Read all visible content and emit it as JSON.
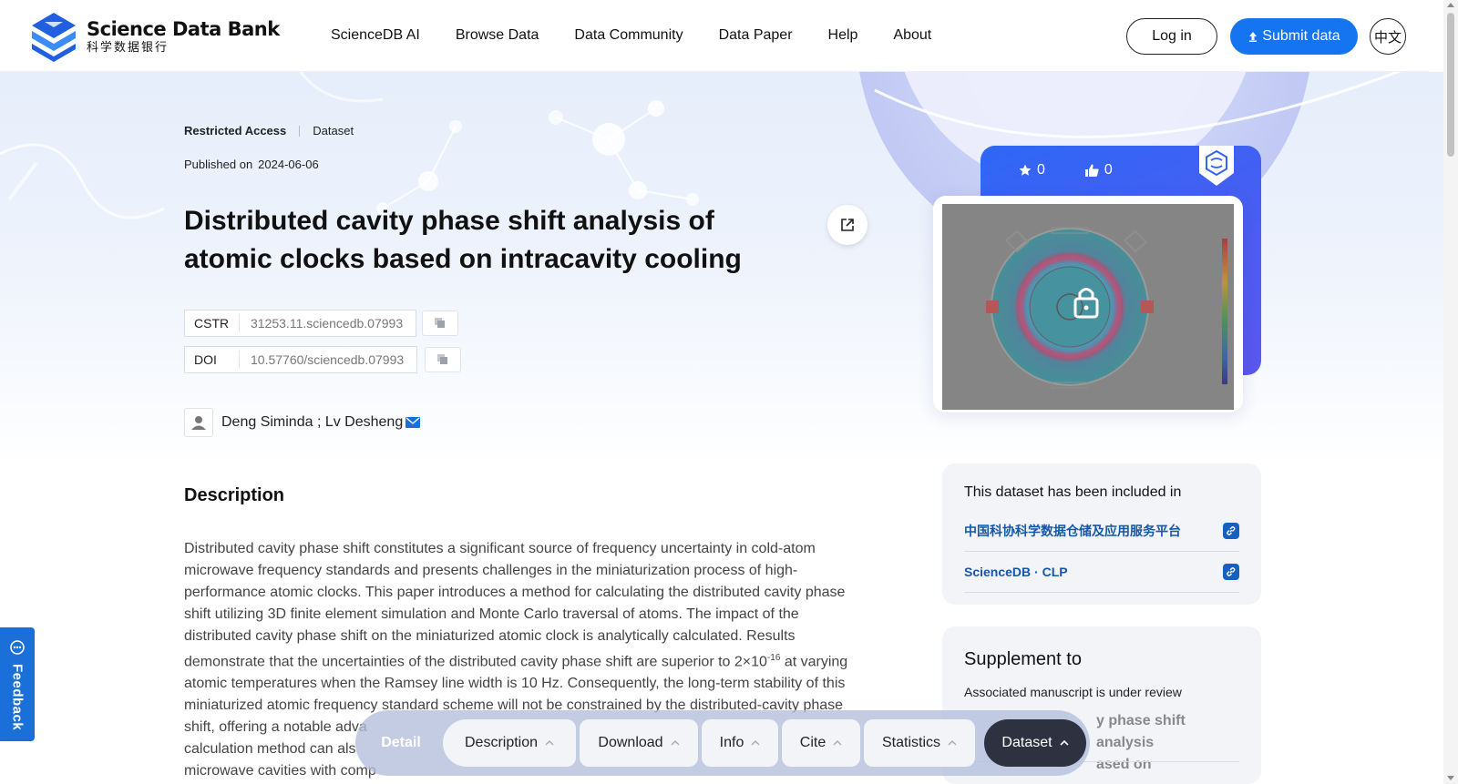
{
  "header": {
    "logo_en": "Science Data Bank",
    "logo_cn": "科学数据银行",
    "nav": [
      "ScienceDB AI",
      "Browse Data",
      "Data Community",
      "Data Paper",
      "Help",
      "About"
    ],
    "login_label": "Log in",
    "submit_label": "Submit data",
    "lang_label": "中文"
  },
  "dataset": {
    "access": "Restricted Access",
    "type": "Dataset",
    "published_label": "Published on",
    "published_date": "2024-06-06",
    "title": "Distributed cavity phase shift analysis of atomic clocks based on intracavity cooling",
    "cstr_label": "CSTR",
    "cstr_value": "31253.11.sciencedb.07993",
    "doi_label": "DOI",
    "doi_value": "10.57760/sciencedb.07993",
    "authors": "Deng Siminda ; Lv Desheng"
  },
  "description": {
    "heading": "Description",
    "text_before_exp": "Distributed cavity phase shift constitutes a significant source of frequency uncertainty in cold-atom microwave frequency standards and presents challenges in the miniaturization process of high-performance atomic clocks. This paper introduces a method for calculating the distributed cavity phase shift utilizing 3D finite element simulation and Monte Carlo traversal of atoms. The impact of the distributed cavity phase shift on the miniaturized atomic clock is analytically calculated. Results demonstrate that the uncertainties of the distributed cavity phase shift are superior to 2×10",
    "exponent": "-16",
    "text_after_exp": " at varying atomic temperatures when the Ramsey line width is 10 Hz. Consequently, the long-term stability of this miniaturized atomic frequency standard scheme will not be constrained by the distributed-cavity phase shift, offering a notable adva",
    "text_line_calc": "calculation method can als",
    "text_line_cavities": "microwave cavities with comp"
  },
  "card": {
    "stars": "0",
    "likes": "0"
  },
  "included": {
    "title": "This dataset has been included in",
    "items": [
      "中国科协科学数据仓储及应用服务平台",
      "ScienceDB · CLP"
    ]
  },
  "supplement": {
    "title": "Supplement to",
    "subtitle": "Associated manuscript is under review",
    "body_line1": "y phase shift analysis",
    "body_line2": "ased on"
  },
  "feedback": {
    "label": "Feedback"
  },
  "float_nav": {
    "detail": "Detail",
    "items": [
      "Description",
      "Download",
      "Info",
      "Cite",
      "Statistics"
    ],
    "active": "Dataset"
  },
  "colors": {
    "primary": "#1574f0",
    "link": "#1557a8",
    "card_gradient_start": "#2e67f5",
    "nav_active": "#2d3140"
  }
}
